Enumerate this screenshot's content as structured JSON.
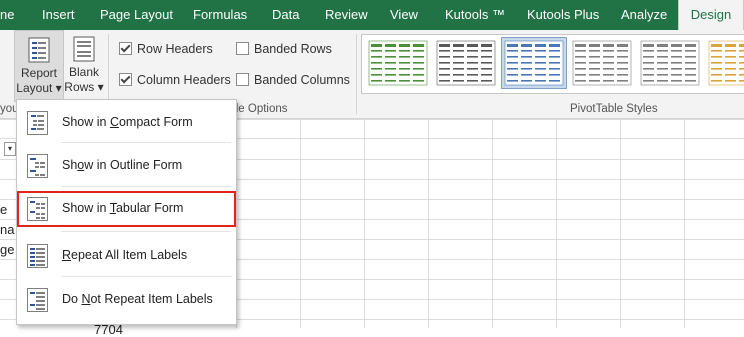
{
  "ribbon_tabs": [
    "ne",
    "Insert",
    "Page Layout",
    "Formulas",
    "Data",
    "Review",
    "View",
    "Kutools ™",
    "Kutools Plus",
    "Analyze",
    "Design"
  ],
  "active_tab": "Design",
  "layout_group": {
    "report_layout": {
      "line1": "Report",
      "line2": "Layout",
      "arrow": "▾"
    },
    "blank_rows": {
      "line1": "Blank",
      "line2": "Rows",
      "arrow": "▾"
    },
    "group_label_fragment": "yout"
  },
  "style_options": {
    "row_headers": {
      "label": "Row Headers",
      "checked": true
    },
    "column_headers": {
      "label": "Column Headers",
      "checked": true
    },
    "banded_rows": {
      "label": "Banded Rows",
      "checked": false
    },
    "banded_columns": {
      "label": "Banded Columns",
      "checked": false
    },
    "group_label_fragment": "yle Options"
  },
  "styles_group": {
    "label": "PivotTable Styles",
    "thumb_colors": [
      "#4b8f3a",
      "#595959",
      "#4a77b4",
      "#7f7f7f",
      "#7f7f7f",
      "#d9a43a"
    ]
  },
  "sheet_fragments": [
    "e",
    "na",
    "ge"
  ],
  "sheet_bottom_fragment": "7704",
  "report_layout_menu": [
    {
      "name": "compact",
      "label": "Show in Compact Form",
      "accel": "C"
    },
    {
      "name": "outline",
      "label": "Show in Outline Form",
      "accel": "o"
    },
    {
      "name": "tabular",
      "label": "Show in Tabular Form",
      "accel": "T",
      "highlighted": true
    },
    {
      "name": "repeat",
      "label": "Repeat All Item Labels",
      "accel": "R"
    },
    {
      "name": "no-repeat",
      "label": "Do Not Repeat Item Labels",
      "accel": "N"
    }
  ],
  "colors": {
    "excel_green": "#217346",
    "highlight_red": "#e1251b"
  }
}
